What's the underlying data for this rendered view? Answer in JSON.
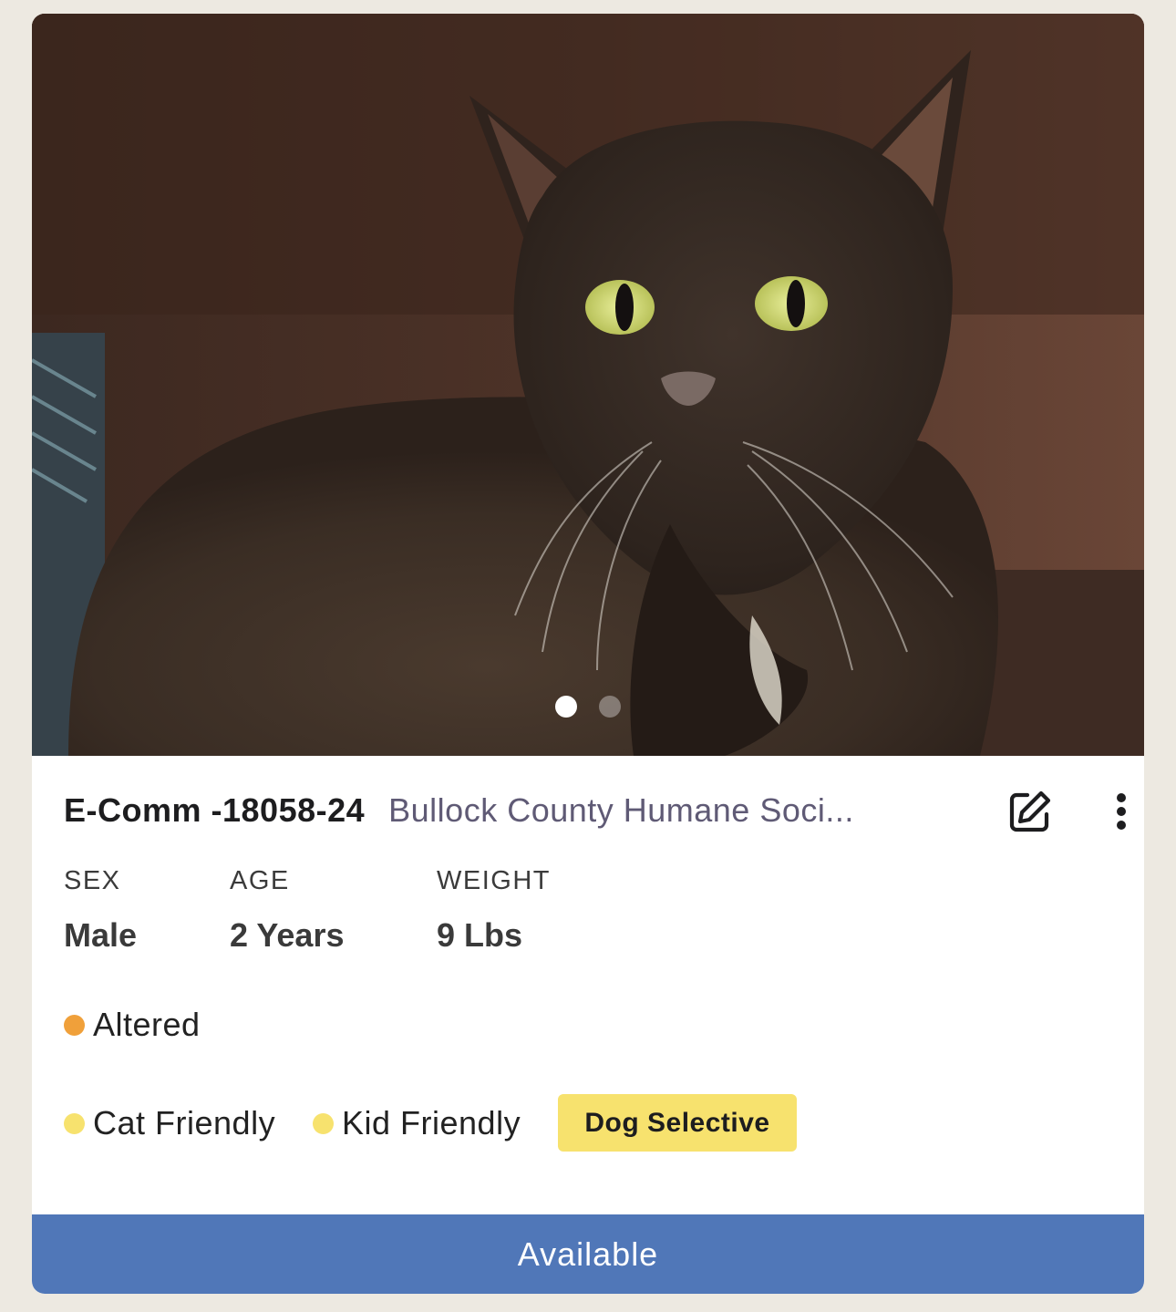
{
  "photo": {
    "alt": "Photo of a dark brown cat with yellow eyes",
    "carousel": {
      "count": 2,
      "active_index": 0
    }
  },
  "header": {
    "animal_id": "E-Comm -18058-24",
    "organization": "Bullock County Humane Soci..."
  },
  "stats": [
    {
      "label": "SEX",
      "value": "Male"
    },
    {
      "label": "AGE",
      "value": "2 Years"
    },
    {
      "label": "WEIGHT",
      "value": "9 Lbs"
    }
  ],
  "status_tags": [
    {
      "label": "Altered",
      "color": "#f0a03a"
    }
  ],
  "friendly_tags": [
    {
      "label": "Cat Friendly",
      "color": "#f7e26e"
    },
    {
      "label": "Kid Friendly",
      "color": "#f7e26e"
    }
  ],
  "badge": {
    "label": "Dog Selective",
    "color": "#f7e26e"
  },
  "availability": {
    "label": "Available",
    "color": "#5077b8"
  }
}
